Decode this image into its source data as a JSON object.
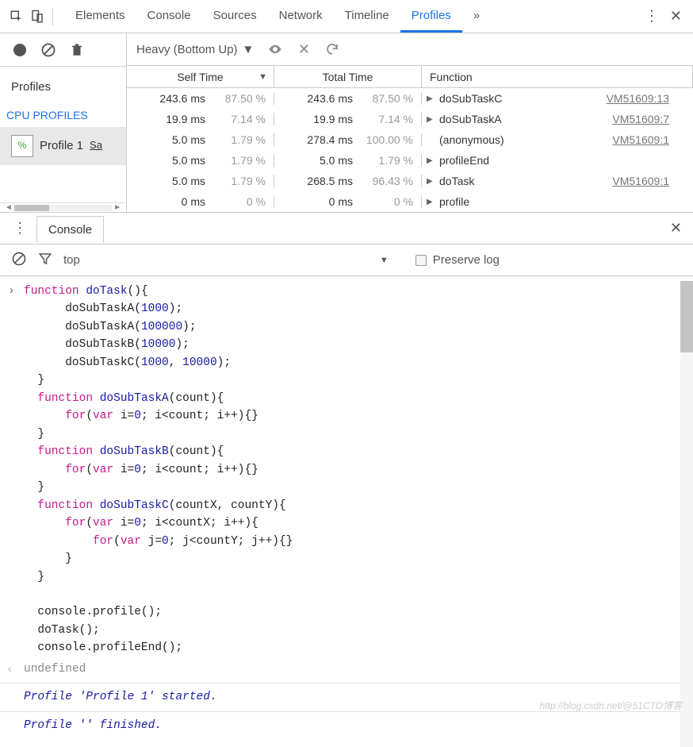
{
  "tabs": [
    "Elements",
    "Console",
    "Sources",
    "Network",
    "Timeline",
    "Profiles"
  ],
  "active_tab": "Profiles",
  "more_indicator": "»",
  "sidebar": {
    "title": "Profiles",
    "section": "CPU PROFILES",
    "item_label": "Profile 1",
    "item_suffix": "Sa"
  },
  "toolbar": {
    "view_mode": "Heavy (Bottom Up)"
  },
  "columns": {
    "self": "Self Time",
    "total": "Total Time",
    "fn": "Function"
  },
  "rows": [
    {
      "self_t": "243.6 ms",
      "self_p": "87.50 %",
      "tot_t": "243.6 ms",
      "tot_p": "87.50 %",
      "tri": "▶",
      "fn": "doSubTaskC",
      "link": "VM51609:13"
    },
    {
      "self_t": "19.9 ms",
      "self_p": "7.14 %",
      "tot_t": "19.9 ms",
      "tot_p": "7.14 %",
      "tri": "▶",
      "fn": "doSubTaskA",
      "link": "VM51609:7"
    },
    {
      "self_t": "5.0 ms",
      "self_p": "1.79 %",
      "tot_t": "278.4 ms",
      "tot_p": "100.00 %",
      "tri": "",
      "fn": "(anonymous)",
      "link": "VM51609:1"
    },
    {
      "self_t": "5.0 ms",
      "self_p": "1.79 %",
      "tot_t": "5.0 ms",
      "tot_p": "1.79 %",
      "tri": "▶",
      "fn": "profileEnd",
      "link": ""
    },
    {
      "self_t": "5.0 ms",
      "self_p": "1.79 %",
      "tot_t": "268.5 ms",
      "tot_p": "96.43 %",
      "tri": "▶",
      "fn": "doTask",
      "link": "VM51609:1"
    },
    {
      "self_t": "0 ms",
      "self_p": "0 %",
      "tot_t": "0 ms",
      "tot_p": "0 %",
      "tri": "▶",
      "fn": "profile",
      "link": ""
    }
  ],
  "drawer": {
    "tab": "Console"
  },
  "console_toolbar": {
    "context": "top",
    "preserve": "Preserve log"
  },
  "console": {
    "ret": "undefined",
    "msg1": "Profile 'Profile 1' started.",
    "msg2": "Profile '' finished."
  },
  "watermark": "http://blog.csdn.net/@51CTO博客"
}
